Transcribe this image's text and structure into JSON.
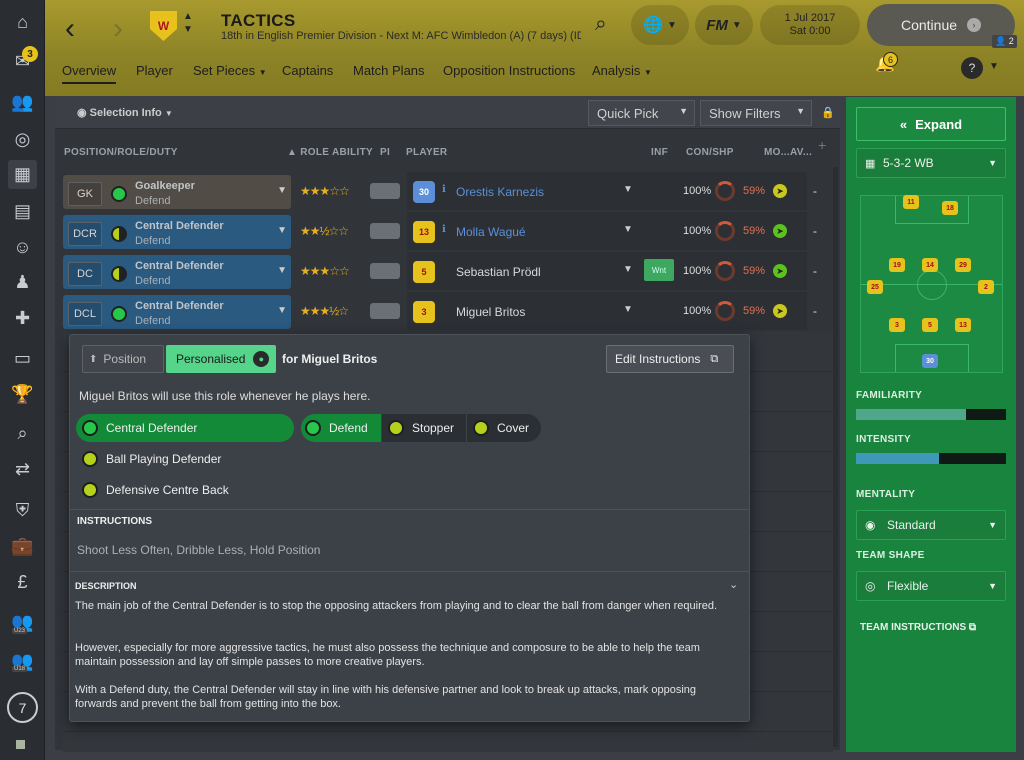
{
  "rail": {
    "badge_count": "3",
    "circle_number": "7",
    "u23": "U23",
    "u18": "U18"
  },
  "header": {
    "title": "TACTICS",
    "subtitle": "18th in English Premier Division - Next M: AFC Wimbledon (A) (7 days) (ID:...",
    "club_badge": "W",
    "date": "1 Jul 2017",
    "time": "Sat 0:00",
    "continue_label": "Continue",
    "fm_label": "FM",
    "online_count": "2",
    "notif_count": "6"
  },
  "tabs": [
    "Overview",
    "Player",
    "Set Pieces",
    "Captains",
    "Match Plans",
    "Opposition Instructions",
    "Analysis"
  ],
  "toolbar": {
    "selection_info": "Selection Info",
    "quick_pick": "Quick Pick",
    "show_filters": "Show Filters"
  },
  "columns": {
    "position": "POSITION/ROLE/DUTY",
    "role_ability": "ROLE ABILITY",
    "pi": "PI",
    "player": "PLAYER",
    "inf": "INF",
    "con_shp": "CON/SHP",
    "mo": "MO...",
    "av": "AV..."
  },
  "rows": [
    {
      "code": "GK",
      "role": "Goalkeeper",
      "duty": "Defend",
      "stars": "★★★☆☆",
      "number": "30",
      "player": "Orestis Karnezis",
      "cond": "100%",
      "sharp": "59%",
      "av": "-"
    },
    {
      "code": "DCR",
      "role": "Central Defender",
      "duty": "Defend",
      "stars": "★★½☆☆",
      "number": "13",
      "player": "Molla Wagué",
      "cond": "100%",
      "sharp": "59%",
      "av": "-"
    },
    {
      "code": "DC",
      "role": "Central Defender",
      "duty": "Defend",
      "stars": "★★★☆☆",
      "number": "5",
      "player": "Sebastian Prödl",
      "inf": "Wnt",
      "cond": "100%",
      "sharp": "59%",
      "av": "-"
    },
    {
      "code": "DCL",
      "role": "Central Defender",
      "duty": "Defend",
      "stars": "★★★½☆",
      "number": "3",
      "player": "Miguel Britos",
      "cond": "100%",
      "sharp": "59%",
      "av": "-"
    }
  ],
  "popup": {
    "position_tab": "Position",
    "personalised_tab": "Personalised",
    "for_player": "for Miguel Britos",
    "edit_instructions": "Edit Instructions",
    "intro": "Miguel Britos will use this role whenever he plays here.",
    "roles": [
      "Central Defender",
      "Ball Playing Defender",
      "Defensive Centre Back"
    ],
    "duties": [
      "Defend",
      "Stopper",
      "Cover"
    ],
    "instructions_header": "INSTRUCTIONS",
    "instructions": "Shoot Less Often, Dribble Less, Hold Position",
    "description_header": "DESCRIPTION",
    "desc1": "The main job of the Central Defender is to stop the opposing attackers from playing and to clear the ball from danger when required.",
    "desc2": "However, especially for more aggressive tactics, he must also possess the technique and composure to be able to help the team maintain possession and lay off simple passes to more creative players.",
    "desc3": "With a Defend duty, the Central Defender will stay in line with his defensive partner and look to break up attacks, mark opposing forwards and prevent the ball from getting into the box."
  },
  "right_panel": {
    "expand": "Expand",
    "formation": "5-3-2 WB",
    "familiarity_label": "FAMILIARITY",
    "familiarity_value": 0.73,
    "intensity_label": "INTENSITY",
    "intensity_value": 0.55,
    "mentality_label": "MENTALITY",
    "mentality": "Standard",
    "team_shape_label": "TEAM SHAPE",
    "team_shape": "Flexible",
    "team_instructions": "TEAM INSTRUCTIONS",
    "pitch_numbers": [
      "11",
      "18",
      "19",
      "14",
      "29",
      "25",
      "2",
      "3",
      "5",
      "13",
      "30"
    ]
  },
  "colors": {
    "accent_green": "#18843e",
    "header_gold": "#a89a2e",
    "kit_yellow": "#e6c21d"
  }
}
